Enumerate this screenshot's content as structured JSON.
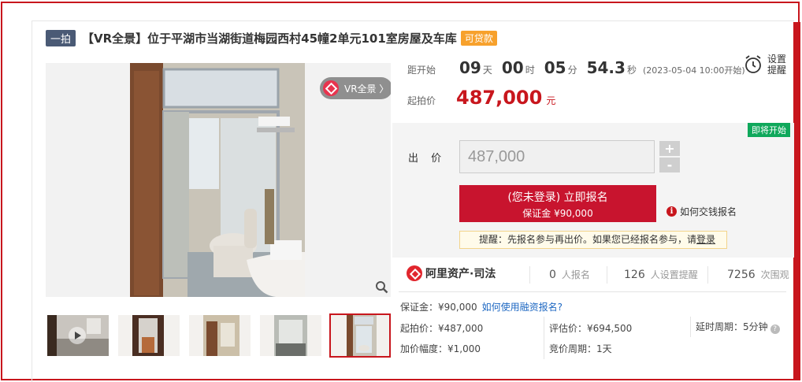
{
  "title": {
    "tag": "一拍",
    "text": "【VR全景】位于平湖市当湖街道梅园西村45幢2单元101室房屋及车库",
    "loan_badge": "可贷款"
  },
  "gallery": {
    "vr_label": "VR全景 〉",
    "zoom_icon": "magnifier-icon",
    "thumbnail_count": 5,
    "selected_thumbnail": 5
  },
  "countdown": {
    "label": "距开始",
    "days": "09",
    "days_unit": "天",
    "hours": "00",
    "hours_unit": "时",
    "minutes": "05",
    "minutes_unit": "分",
    "seconds": "54.3",
    "seconds_unit": "秒",
    "start_time": "(2023-05-04 10:00开始)"
  },
  "remind": {
    "line1": "设置",
    "line2": "提醒",
    "icon": "alarm-clock-icon"
  },
  "start_price": {
    "label": "起拍价",
    "value": "487,000",
    "unit": "元"
  },
  "bid": {
    "status_badge": "即将开始",
    "label": "出 价",
    "input_value": "487,000",
    "plus": "+",
    "minus": "-",
    "register_line1": "(您未登录) 立即报名",
    "register_line2": "保证金 ¥90,000",
    "pay_help": "如何交钱报名",
    "reminder_prefix": "提醒：先报名参与再出价。如果您已经报名参与，请",
    "reminder_link": "登录"
  },
  "stats": {
    "brand": "阿里资产·司法",
    "signups_num": "0",
    "signups_label": "人报名",
    "reminders_num": "126",
    "reminders_label": "人设置提醒",
    "views_num": "7256",
    "views_label": "次围观"
  },
  "details": {
    "deposit": "保证金：¥90,000",
    "deposit_link": "如何使用融资报名?",
    "start_price": "起拍价：¥487,000",
    "appraisal": "评估价：¥694,500",
    "delay": "延时周期：5分钟",
    "increment": "加价幅度：¥1,000",
    "cycle": "竞价周期：1天"
  },
  "colors": {
    "accent_red": "#c8161d",
    "register_red": "#c8142e",
    "badge_green": "#0fa85b",
    "loan_orange": "#f7a12c",
    "link_blue": "#1d67c2"
  }
}
